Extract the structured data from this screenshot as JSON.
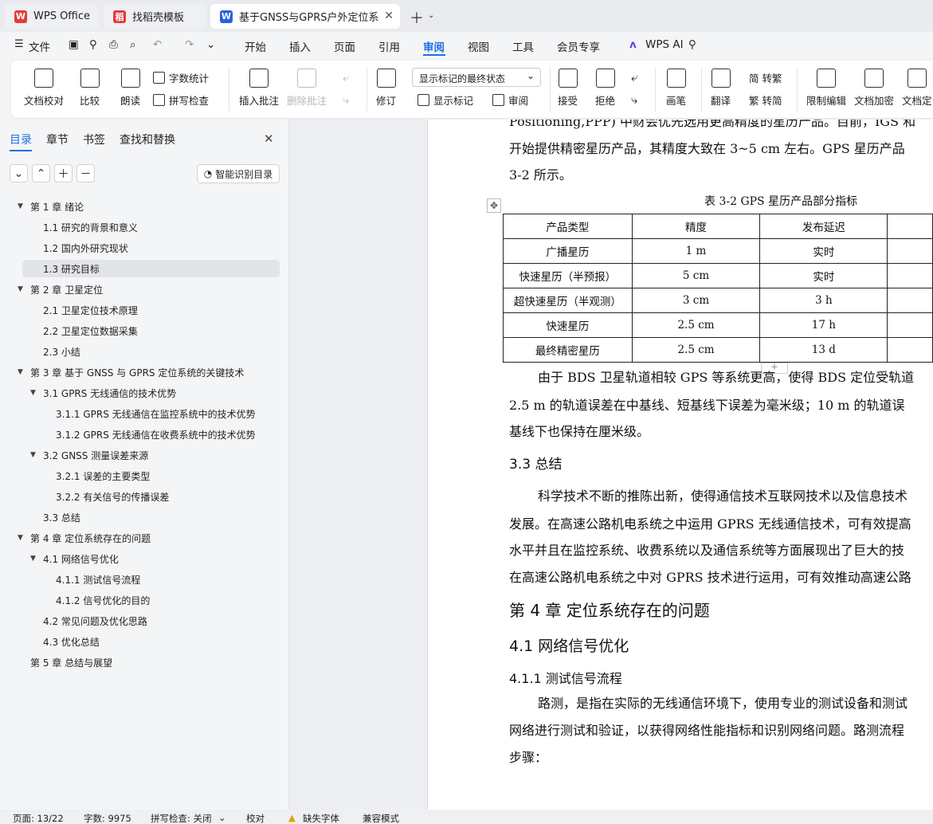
{
  "tabs": [
    {
      "label": "WPS Office",
      "icon": "wps-logo-icon",
      "color": "#e23b3b"
    },
    {
      "label": "找稻壳模板",
      "icon": "docer-icon",
      "color": "#e23b3b"
    },
    {
      "label": "基于GNSS与GPRS户外定位系",
      "icon": "word-doc-icon",
      "color": "#2b5fe0"
    }
  ],
  "menu": {
    "file": "文件",
    "items": [
      "开始",
      "插入",
      "页面",
      "引用",
      "审阅",
      "视图",
      "工具",
      "会员专享"
    ],
    "active": "审阅",
    "ai": "WPS AI"
  },
  "ribbon": {
    "doc_check": "文档校对",
    "compare": "比较",
    "read": "朗读",
    "word_count": "字数统计",
    "spell": "拼写检查",
    "insert_comment": "插入批注",
    "delete_comment": "删除批注",
    "revise": "修订",
    "markup_state": "显示标记的最终状态",
    "show_markup": "显示标记",
    "review": "审阅",
    "accept": "接受",
    "reject": "拒绝",
    "pen": "画笔",
    "translate": "翻译",
    "to_trad": "简 转繁",
    "to_simp": "繁 转简",
    "restrict": "限制编辑",
    "encrypt": "文档加密",
    "doc_final": "文档定"
  },
  "sidebar": {
    "tabs": [
      "目录",
      "章节",
      "书签",
      "查找和替换"
    ],
    "smart_btn": "智能识别目录",
    "toc": [
      {
        "label": "第 1 章 绪论",
        "level": 1,
        "arrow": true
      },
      {
        "label": "1.1 研究的背景和意义",
        "level": 2
      },
      {
        "label": "1.2 国内外研究现状",
        "level": 2
      },
      {
        "label": "1.3 研究目标",
        "level": 2,
        "selected": true
      },
      {
        "label": "第 2 章 卫星定位",
        "level": 1,
        "arrow": true
      },
      {
        "label": "2.1 卫星定位技术原理",
        "level": 2
      },
      {
        "label": "2.2 卫星定位数据采集",
        "level": 2
      },
      {
        "label": "2.3 小结",
        "level": 2
      },
      {
        "label": "第 3 章 基于 GNSS 与 GPRS 定位系统的关键技术",
        "level": 1,
        "arrow": true
      },
      {
        "label": "3.1 GPRS 无线通信的技术优势",
        "level": 2,
        "arrow": true
      },
      {
        "label": "3.1.1 GPRS 无线通信在监控系统中的技术优势",
        "level": 3
      },
      {
        "label": "3.1.2 GPRS 无线通信在收费系统中的技术优势",
        "level": 3
      },
      {
        "label": "3.2 GNSS 测量误差来源",
        "level": 2,
        "arrow": true
      },
      {
        "label": "3.2.1 误差的主要类型",
        "level": 3
      },
      {
        "label": "3.2.2 有关信号的传播误差",
        "level": 3
      },
      {
        "label": "3.3 总结",
        "level": 2
      },
      {
        "label": "第 4 章 定位系统存在的问题",
        "level": 1,
        "arrow": true
      },
      {
        "label": "4.1 网络信号优化",
        "level": 2,
        "arrow": true
      },
      {
        "label": "4.1.1 测试信号流程",
        "level": 3
      },
      {
        "label": "4.1.2 信号优化的目的",
        "level": 3
      },
      {
        "label": "4.2 常见问题及优化思路",
        "level": 2
      },
      {
        "label": "4.3 优化总结",
        "level": 2
      },
      {
        "label": "第 5 章 总结与展望",
        "level": 1
      }
    ]
  },
  "doc": {
    "line0": "Positioning,PPP)  中财会优先选用更高精度的星历产品。目前，IGS 和",
    "line1": "开始提供精密星历产品，其精度大致在 3~5 cm  左右。GPS 星历产品",
    "line2": "3-2  所示。",
    "table_caption": "表 3-2   GPS 星历产品部分指标",
    "table_header": [
      "产品类型",
      "精度",
      "发布延迟",
      ""
    ],
    "table_rows": [
      [
        "广播星历",
        "1 m",
        "实时",
        ""
      ],
      [
        "快速星历（半预报）",
        "5 cm",
        "实时",
        ""
      ],
      [
        "超快速星历（半观测）",
        "3 cm",
        "3 h",
        ""
      ],
      [
        "快速星历",
        "2.5 cm",
        "17 h",
        ""
      ],
      [
        "最终精密星历",
        "2.5 cm",
        "13 d",
        ""
      ]
    ],
    "para1a": "由于 BDS 卫星轨道相较 GPS 等系统更高，使得 BDS 定位受轨道",
    "para1b": "2.5 m  的轨道误差在中基线、短基线下误差为毫米级；10 m 的轨道误",
    "para1c": "基线下也保持在厘米级。",
    "h33": "3.3  总结",
    "para2a": "科学技术不断的推陈出新，使得通信技术互联网技术以及信息技术",
    "para2b": "发展。在高速公路机电系统之中运用 GPRS 无线通信技术，可有效提高",
    "para2c": "水平并且在监控系统、收费系统以及通信系统等方面展现出了巨大的技",
    "para2d": "在高速公路机电系统之中对 GPRS 技术进行运用，可有效推动高速公路",
    "h4": "第 4 章  定位系统存在的问题",
    "h41": "4.1  网络信号优化",
    "h411": "4.1.1  测试信号流程",
    "para3a": "路测，是指在实际的无线通信环境下，使用专业的测试设备和测试",
    "para3b": "网络进行测试和验证，以获得网络性能指标和识别网络问题。路测流程",
    "para3c": "步骤："
  },
  "status": {
    "page": "页面: 13/22",
    "words": "字数: 9975",
    "spell": "拼写检查: 关闭",
    "proof": "校对",
    "missing_font": "缺失字体",
    "compat": "兼容模式"
  }
}
